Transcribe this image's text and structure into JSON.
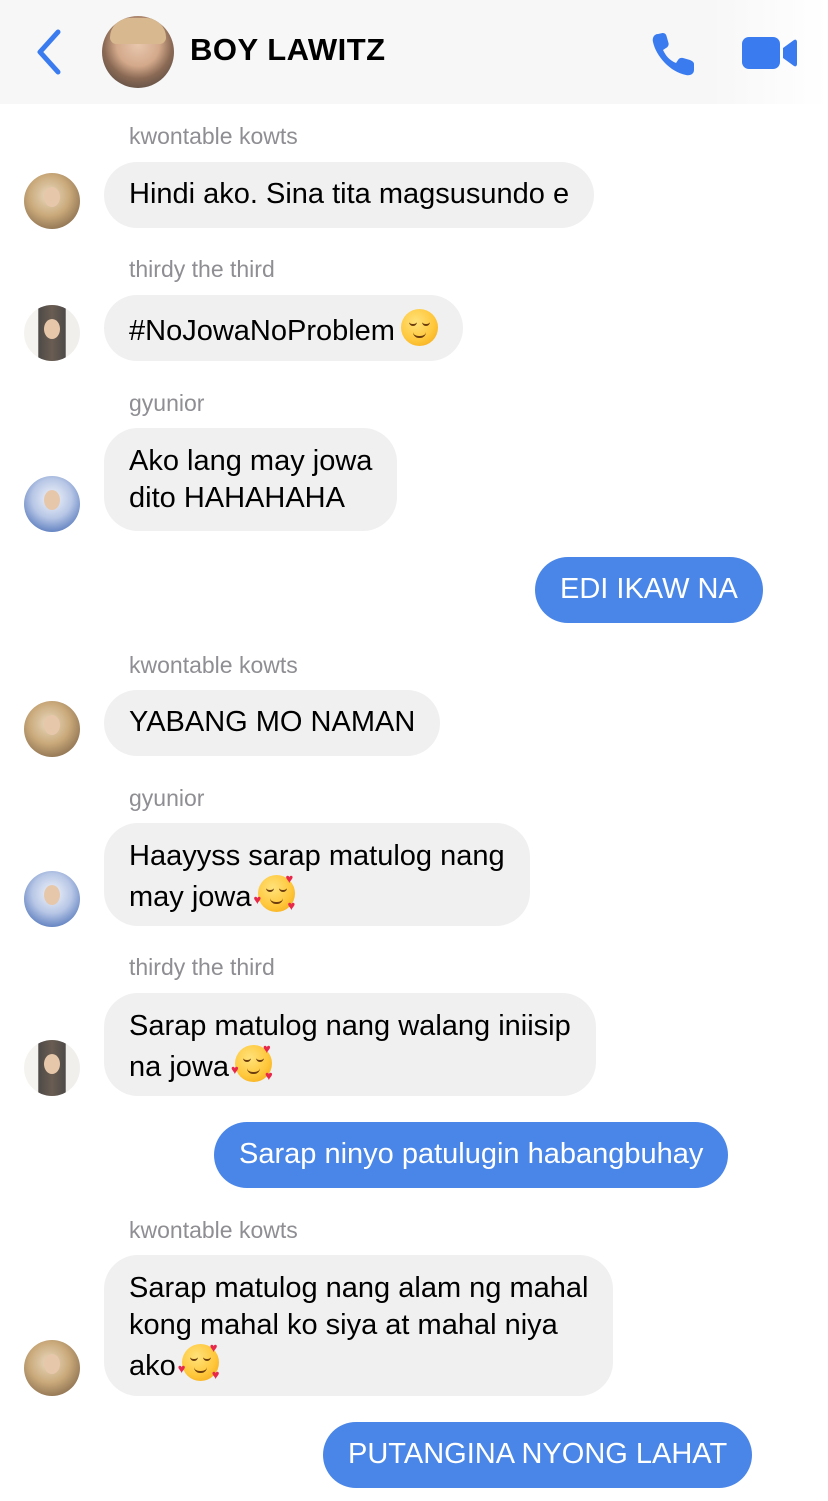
{
  "header": {
    "title": "BOY LAWITZ",
    "back_icon": "chevron-left-icon",
    "call_icon": "phone-icon",
    "video_icon": "video-camera-icon",
    "accent_color": "#3a7cf0"
  },
  "messages": [
    {
      "type": "in",
      "sender": "kwontable kowts",
      "text": "Hindi ako. Sina tita magsusundo e",
      "emoji": ""
    },
    {
      "type": "in",
      "sender": "thirdy the third",
      "text": "#NoJowaNoProblem",
      "emoji": "relieved-face-emoji"
    },
    {
      "type": "in",
      "sender": "gyunior",
      "text": "Ako lang may jowa\ndito HAHAHAHA",
      "emoji": ""
    },
    {
      "type": "out",
      "text": "EDI IKAW NA"
    },
    {
      "type": "in",
      "sender": "kwontable kowts",
      "text": "YABANG MO NAMAN",
      "emoji": ""
    },
    {
      "type": "in",
      "sender": "gyunior",
      "text": "Haayyss sarap matulog nang\nmay jowa",
      "emoji": "smiling-face-with-hearts-emoji"
    },
    {
      "type": "in",
      "sender": "thirdy the third",
      "text": "Sarap matulog nang walang iniisip\nna jowa",
      "emoji": "smiling-face-with-hearts-emoji"
    },
    {
      "type": "out",
      "text": "Sarap ninyo patulugin habangbuhay"
    },
    {
      "type": "in",
      "sender": "kwontable kowts",
      "text": "Sarap matulog nang alam ng mahal\nkong mahal ko siya at mahal niya\nako",
      "emoji": "smiling-face-with-hearts-emoji"
    },
    {
      "type": "out",
      "text": "PUTANGINA NYONG LAHAT"
    }
  ],
  "colors": {
    "incoming_bubble": "#f0f0f0",
    "outgoing_bubble": "#4a86e8",
    "sender_name": "#8e8e93"
  }
}
